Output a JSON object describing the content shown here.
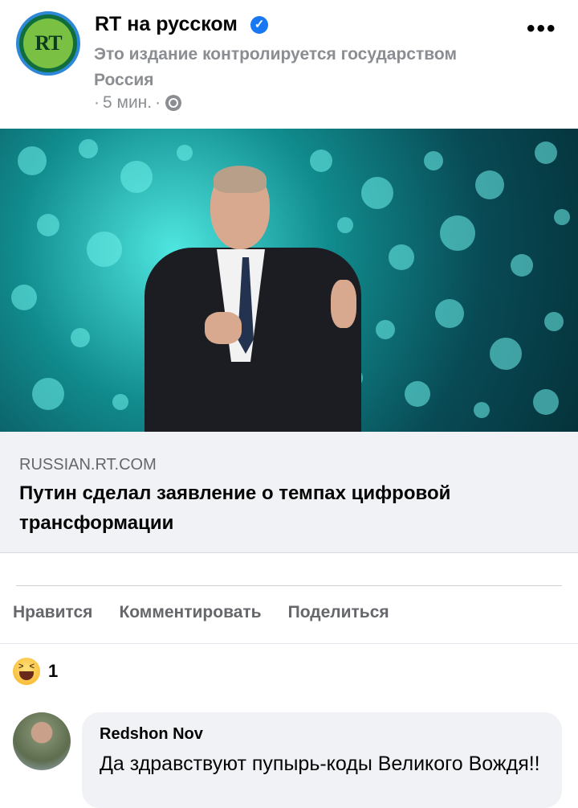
{
  "post": {
    "page_name": "RT на русском",
    "avatar_text": "RT",
    "verified_mark": "✓",
    "state_note": "Это издание контролируется государством Россия",
    "meta_prefix": "·",
    "time": "5 мин.",
    "meta_sep": "·",
    "privacy_icon": "globe-icon",
    "more_label": "•••"
  },
  "link": {
    "domain": "RUSSIAN.RT.COM",
    "title": "Путин сделал заявление о темпах цифровой трансформации"
  },
  "actions": {
    "like": "Нравится",
    "comment": "Комментировать",
    "share": "Поделиться"
  },
  "reactions": {
    "icon": "haha-icon",
    "count": "1"
  },
  "comment": {
    "author": "Redshon Nov",
    "text": "Да здравствуют пупырь-коды Великого Вождя!!"
  },
  "colors": {
    "accent": "#1877f2",
    "secondary_text": "#65676b",
    "card_bg": "#f0f2f5"
  }
}
